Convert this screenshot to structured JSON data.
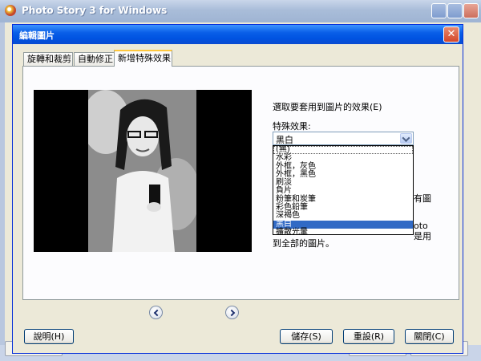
{
  "main_window": {
    "title": "Photo Story 3 for Windows"
  },
  "dialog": {
    "title": "編輯圖片",
    "close_glyph": "✕",
    "tabs": [
      "旋轉和裁剪",
      "自動修正",
      "新增特殊效果"
    ],
    "active_tab": 2
  },
  "effects": {
    "instruction": "選取要套用到圖片的效果(E)",
    "dropdown_label": "特殊效果:",
    "selected_value": "黑白",
    "options": [
      "(無)",
      "水彩",
      "外框，灰色",
      "外框，黑色",
      "刷淡",
      "負片",
      "粉筆和炭筆",
      "彩色鉛筆",
      "深褐色",
      "黑白",
      "擴散光暈"
    ],
    "highlighted_option": 9,
    "partial_text_1": "有圖",
    "partial_text_2": "oto",
    "partial_text_3": "是用",
    "partial_text_4": "到全部的圖片。"
  },
  "buttons": {
    "help": "說明(H)",
    "save": "儲存(S)",
    "reset": "重設(R)",
    "close": "關閉(C)"
  }
}
